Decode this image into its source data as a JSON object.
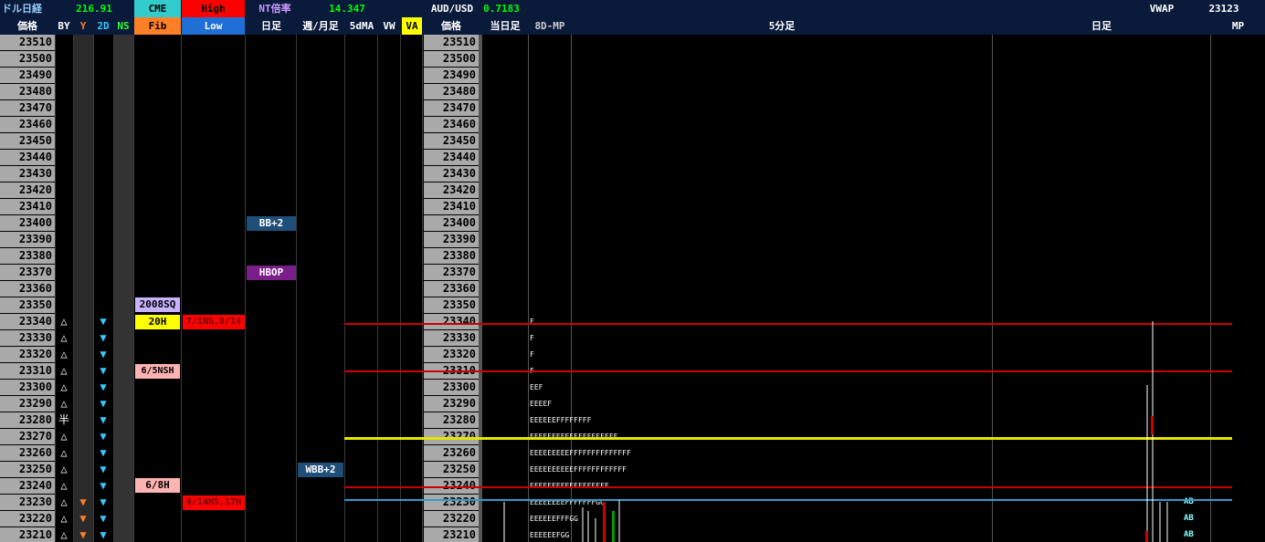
{
  "header1": {
    "nikkei_label": "ドル日経",
    "nikkei_value": "216.91",
    "cme": "CME",
    "high": "High",
    "nt_label": "NT倍率",
    "nt_value": "14.347",
    "aud_label": "AUD/USD",
    "aud_value": "0.7183",
    "vwap_label": "VWAP",
    "vwap_value": "23123"
  },
  "header2": {
    "price": "価格",
    "by": "BY",
    "y": "Y",
    "d2": "2D",
    "ns": "NS",
    "fib": "Fib",
    "low": "Low",
    "daily": "日足",
    "weekly": "週/月足",
    "ma5": "5dMA",
    "vw": "VW",
    "va": "VA",
    "price2": "価格",
    "today": "当日足",
    "mp8d": "8D-MP",
    "min5": "5分足",
    "daily2": "日足",
    "mp": "MP"
  },
  "colors": {
    "header_bg": "#0a1a3a",
    "price_bg": "#a9a9a9",
    "up": "#ffffff",
    "down": "#33ccff",
    "y_marker": "#ff7f27",
    "red_line": "#cc0000",
    "yellow_line": "#e6e600",
    "blue_line": "#3399cc"
  },
  "prices": [
    "23510",
    "23500",
    "23490",
    "23480",
    "23470",
    "23460",
    "23450",
    "23440",
    "23430",
    "23420",
    "23410",
    "23400",
    "23390",
    "23380",
    "23370",
    "23360",
    "23350",
    "23340",
    "23330",
    "23320",
    "23310",
    "23300",
    "23290",
    "23280",
    "23270",
    "23260",
    "23250",
    "23240",
    "23230",
    "23220",
    "23210"
  ],
  "by_signals": [
    "",
    "",
    "",
    "",
    "",
    "",
    "",
    "",
    "",
    "",
    "",
    "",
    "",
    "",
    "",
    "",
    "",
    "△",
    "△",
    "△",
    "△",
    "△",
    "△",
    "半",
    "△",
    "△",
    "△",
    "△",
    "△",
    "△",
    "△"
  ],
  "y_signals": [
    false,
    false,
    false,
    false,
    false,
    false,
    false,
    false,
    false,
    false,
    false,
    false,
    false,
    false,
    false,
    false,
    false,
    false,
    false,
    false,
    false,
    false,
    false,
    false,
    false,
    false,
    false,
    false,
    true,
    true,
    true
  ],
  "d2_signals": [
    false,
    false,
    false,
    false,
    false,
    false,
    false,
    false,
    false,
    false,
    false,
    false,
    false,
    false,
    false,
    false,
    false,
    true,
    true,
    true,
    true,
    true,
    true,
    true,
    true,
    true,
    true,
    true,
    true,
    true,
    true
  ],
  "tags": {
    "bb2": "BB+2",
    "hbop": "HBOP",
    "sq2008": "2008SQ",
    "h20": "20H",
    "ns21": "7/1NS,9/14",
    "nsh65": "6/5NSH",
    "wbb2": "WBB+2",
    "h68": "6/8H",
    "ns14": "6/14NS,17H"
  },
  "tpo": {
    "23340": "F",
    "23330": "F",
    "23320": "F",
    "23310": "F",
    "23300": "EEF",
    "23290": "EEEEF",
    "23280": "EEEEEEFFFFFFFF",
    "23270": "EEEEEEEEEFFFFFFFFFFF",
    "23260": "EEEEEEEEEFFFFFFFFFFFFFF",
    "23250": "EEEEEEEEEEFFFFFFFFFFFF",
    "23240": "EEEEEEEEEEEFFFFFFF",
    "23230": "EEEEEEEEFFFFFFFGG",
    "23220": "EEEEEEFFFGG",
    "23210": "EEEEEEFGG"
  },
  "ab_labels": [
    "AB",
    "AB",
    "AB"
  ]
}
